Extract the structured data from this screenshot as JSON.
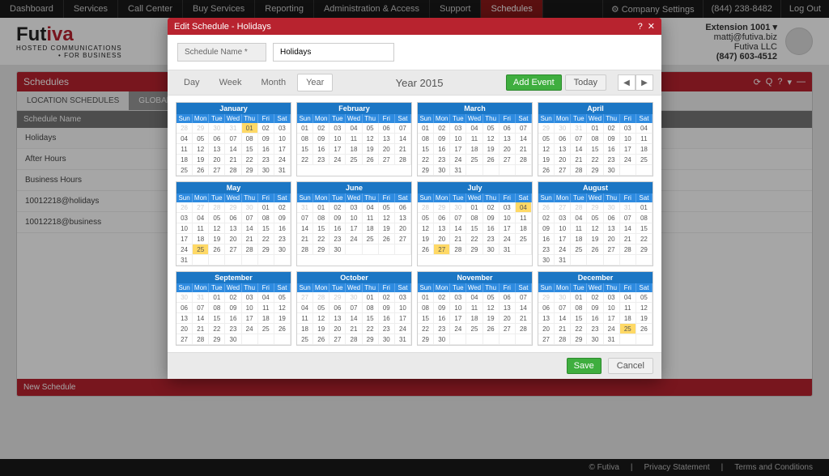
{
  "nav": {
    "items": [
      "Dashboard",
      "Services",
      "Call Center",
      "Buy Services",
      "Reporting",
      "Administration & Access",
      "Support",
      "Schedules"
    ],
    "active": 7,
    "settings": "Company Settings",
    "phone": "(844) 238-8482",
    "logout": "Log Out"
  },
  "logo": {
    "brand": "Fut",
    "brand2": "iva",
    "sub": "HOSTED COMMUNICATIONS",
    "sub2": "• FOR BUSINESS"
  },
  "ext": {
    "title": "Extension 1001",
    "arrow": "▾",
    "email": "mattj@futiva.biz",
    "org": "Futiva LLC",
    "phone": "(847) 603-4512"
  },
  "panel": {
    "title": "Schedules"
  },
  "tabs": {
    "a": "LOCATION SCHEDULES",
    "b": "GLOBAL SCHEDULES"
  },
  "list": {
    "head": "Schedule Name",
    "rows": [
      "Holidays",
      "After Hours",
      "Business Hours",
      "10012218@holidays",
      "10012218@business"
    ],
    "new": "New Schedule"
  },
  "modal": {
    "title": "Edit Schedule - Holidays",
    "name_label": "Schedule Name *",
    "name_value": "Holidays"
  },
  "view": {
    "day": "Day",
    "week": "Week",
    "month": "Month",
    "year": "Year",
    "title": "Year 2015",
    "add": "Add Event",
    "today": "Today"
  },
  "dow": [
    "Sun",
    "Mon",
    "Tue",
    "Wed",
    "Thu",
    "Fri",
    "Sat"
  ],
  "months": [
    {
      "name": "January",
      "lead": 4,
      "days": 31,
      "prev": [
        28,
        29,
        30,
        31
      ],
      "hl": [
        1
      ]
    },
    {
      "name": "February",
      "lead": 0,
      "days": 28,
      "prev": [],
      "hl": []
    },
    {
      "name": "March",
      "lead": 0,
      "days": 31,
      "prev": [],
      "hl": []
    },
    {
      "name": "April",
      "lead": 3,
      "days": 30,
      "prev": [
        29,
        30,
        31
      ],
      "hl": []
    },
    {
      "name": "May",
      "lead": 5,
      "days": 31,
      "prev": [
        26,
        27,
        28,
        29,
        30
      ],
      "hl": [
        25
      ]
    },
    {
      "name": "June",
      "lead": 1,
      "days": 30,
      "prev": [
        31
      ],
      "hl": []
    },
    {
      "name": "July",
      "lead": 3,
      "days": 31,
      "prev": [
        28,
        29,
        30
      ],
      "hl": [
        4,
        27
      ]
    },
    {
      "name": "August",
      "lead": 6,
      "days": 31,
      "prev": [
        26,
        27,
        28,
        29,
        30,
        31
      ],
      "hl": []
    },
    {
      "name": "September",
      "lead": 2,
      "days": 30,
      "prev": [
        30,
        31
      ],
      "hl": []
    },
    {
      "name": "October",
      "lead": 4,
      "days": 31,
      "prev": [
        27,
        28,
        29,
        30
      ],
      "hl": []
    },
    {
      "name": "November",
      "lead": 0,
      "days": 30,
      "prev": [],
      "hl": []
    },
    {
      "name": "December",
      "lead": 2,
      "days": 31,
      "prev": [
        29,
        30
      ],
      "hl": [
        25
      ]
    }
  ],
  "buttons": {
    "save": "Save",
    "cancel": "Cancel"
  },
  "footer": {
    "copy": "© Futiva",
    "privacy": "Privacy Statement",
    "terms": "Terms and Conditions"
  }
}
